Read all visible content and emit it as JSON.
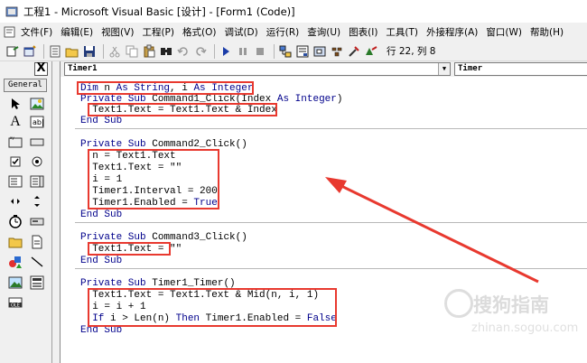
{
  "window": {
    "title": "工程1 - Microsoft Visual Basic [设计] - [Form1 (Code)]"
  },
  "menu": {
    "items": [
      "文件(F)",
      "编辑(E)",
      "视图(V)",
      "工程(P)",
      "格式(O)",
      "调试(D)",
      "运行(R)",
      "查询(U)",
      "图表(I)",
      "工具(T)",
      "外接程序(A)",
      "窗口(W)",
      "帮助(H)"
    ]
  },
  "toolbar": {
    "position": "行 22, 列 8"
  },
  "toolbox": {
    "close_label": "X",
    "tab_label": "General"
  },
  "code_window": {
    "object_combo": "Timer1",
    "proc_combo": "Timer"
  },
  "code": {
    "b1": [
      "Dim n As String, i As Integer",
      "Private Sub Command1_Click(Index As Integer)",
      "  Text1.Text = Text1.Text & Index",
      "End Sub"
    ],
    "b2": [
      "Private Sub Command2_Click()",
      "  n = Text1.Text",
      "  Text1.Text = \"\"",
      "  i = 1",
      "  Timer1.Interval = 200",
      "  Timer1.Enabled = True",
      "End Sub"
    ],
    "b3": [
      "Private Sub Command3_Click()",
      "  Text1.Text = \"\"",
      "End Sub"
    ],
    "b4": [
      "Private Sub Timer1_Timer()",
      "  Text1.Text = Text1.Text & Mid(n, i, 1)",
      "  i = i + 1",
      "  If i > Len(n) Then Timer1.Enabled = False",
      "End Sub"
    ]
  },
  "watermark": {
    "text": "搜狗指南",
    "sub": "zhinan.sogou.com"
  },
  "colors": {
    "highlight": "#e8392f",
    "keyword": "#00008b"
  }
}
